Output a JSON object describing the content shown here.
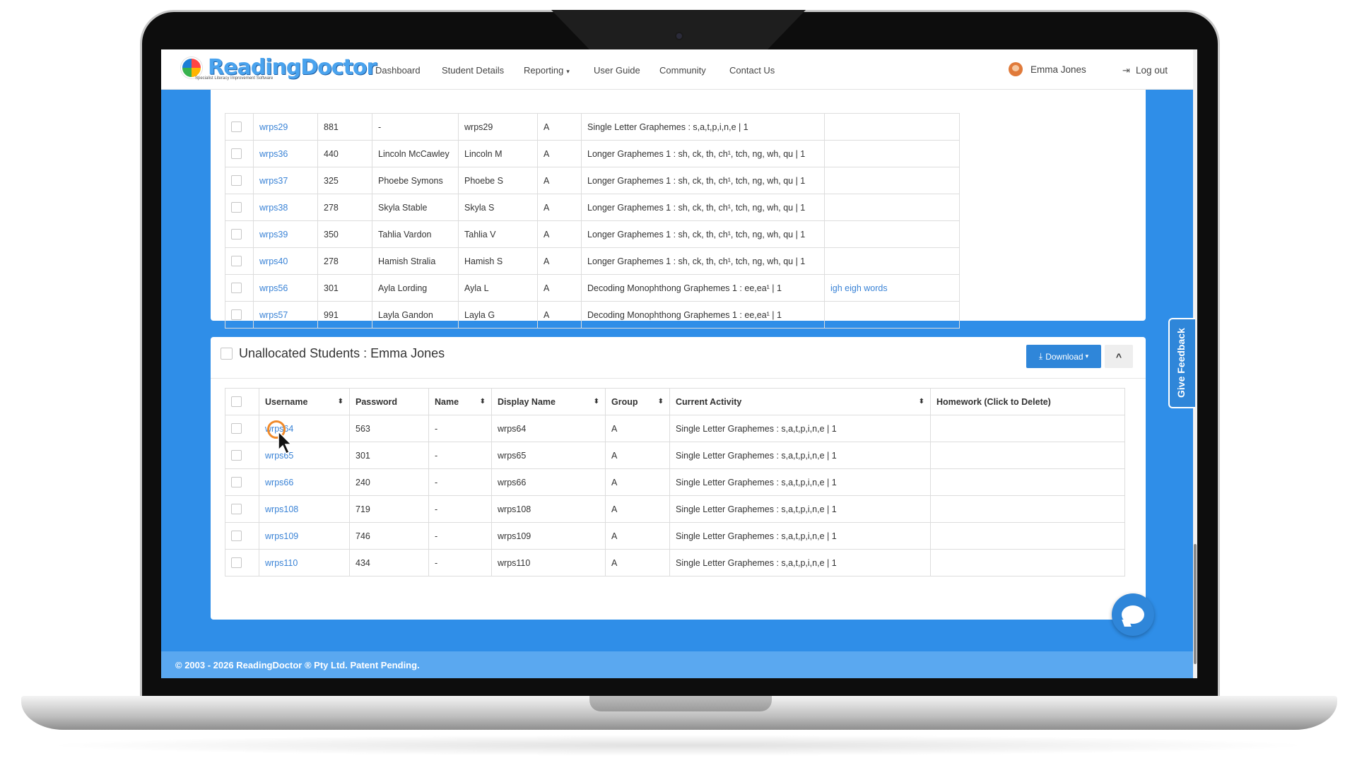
{
  "brand": {
    "name": "ReadingDoctor",
    "tagline": "Specialist Literacy Improvement Software"
  },
  "nav": {
    "items": [
      {
        "label": "Dashboard"
      },
      {
        "label": "Student Details"
      },
      {
        "label": "Reporting",
        "caret": "▾"
      },
      {
        "label": "User Guide"
      },
      {
        "label": "Community"
      },
      {
        "label": "Contact Us"
      }
    ],
    "user_name": "Emma Jones",
    "logout_label": "Log out",
    "logout_icon": "⇥"
  },
  "top_table": {
    "rows": [
      {
        "username": "wrps29",
        "password": "881",
        "name": "-",
        "display": "wrps29",
        "group": "A",
        "activity": "Single Letter Graphemes : s,a,t,p,i,n,e | 1",
        "homework": ""
      },
      {
        "username": "wrps36",
        "password": "440",
        "name": "Lincoln McCawley",
        "display": "Lincoln M",
        "group": "A",
        "activity": "Longer Graphemes 1 : sh, ck, th, ch¹, tch, ng, wh, qu | 1",
        "homework": ""
      },
      {
        "username": "wrps37",
        "password": "325",
        "name": "Phoebe Symons",
        "display": "Phoebe S",
        "group": "A",
        "activity": "Longer Graphemes 1 : sh, ck, th, ch¹, tch, ng, wh, qu | 1",
        "homework": ""
      },
      {
        "username": "wrps38",
        "password": "278",
        "name": "Skyla Stable",
        "display": "Skyla S",
        "group": "A",
        "activity": "Longer Graphemes 1 : sh, ck, th, ch¹, tch, ng, wh, qu | 1",
        "homework": ""
      },
      {
        "username": "wrps39",
        "password": "350",
        "name": "Tahlia Vardon",
        "display": "Tahlia V",
        "group": "A",
        "activity": "Longer Graphemes 1 : sh, ck, th, ch¹, tch, ng, wh, qu | 1",
        "homework": ""
      },
      {
        "username": "wrps40",
        "password": "278",
        "name": "Hamish Stralia",
        "display": "Hamish S",
        "group": "A",
        "activity": "Longer Graphemes 1 : sh, ck, th, ch¹, tch, ng, wh, qu | 1",
        "homework": ""
      },
      {
        "username": "wrps56",
        "password": "301",
        "name": "Ayla Lording",
        "display": "Ayla L",
        "group": "A",
        "activity": "Decoding Monophthong Graphemes 1 : ee,ea¹ | 1",
        "homework": "igh eigh words"
      },
      {
        "username": "wrps57",
        "password": "991",
        "name": "Layla Gandon",
        "display": "Layla G",
        "group": "A",
        "activity": "Decoding Monophthong Graphemes 1 : ee,ea¹ | 1",
        "homework": ""
      }
    ]
  },
  "unallocated": {
    "title": "Unallocated Students : Emma Jones",
    "download_label": "Download",
    "download_icon": "⤓",
    "collapse_icon": "^",
    "headers": {
      "username": "Username",
      "password": "Password",
      "name": "Name",
      "display": "Display Name",
      "group": "Group",
      "activity": "Current Activity",
      "homework": "Homework (Click to Delete)"
    },
    "sort_icon": "⬍",
    "rows": [
      {
        "username": "wrps64",
        "password": "563",
        "name": "-",
        "display": "wrps64",
        "group": "A",
        "activity": "Single Letter Graphemes : s,a,t,p,i,n,e | 1",
        "homework": ""
      },
      {
        "username": "wrps65",
        "password": "301",
        "name": "-",
        "display": "wrps65",
        "group": "A",
        "activity": "Single Letter Graphemes : s,a,t,p,i,n,e | 1",
        "homework": ""
      },
      {
        "username": "wrps66",
        "password": "240",
        "name": "-",
        "display": "wrps66",
        "group": "A",
        "activity": "Single Letter Graphemes : s,a,t,p,i,n,e | 1",
        "homework": ""
      },
      {
        "username": "wrps108",
        "password": "719",
        "name": "-",
        "display": "wrps108",
        "group": "A",
        "activity": "Single Letter Graphemes : s,a,t,p,i,n,e | 1",
        "homework": ""
      },
      {
        "username": "wrps109",
        "password": "746",
        "name": "-",
        "display": "wrps109",
        "group": "A",
        "activity": "Single Letter Graphemes : s,a,t,p,i,n,e | 1",
        "homework": ""
      },
      {
        "username": "wrps110",
        "password": "434",
        "name": "-",
        "display": "wrps110",
        "group": "A",
        "activity": "Single Letter Graphemes : s,a,t,p,i,n,e | 1",
        "homework": ""
      }
    ]
  },
  "footer": {
    "text": "© 2003 - 2026 ReadingDoctor ® Pty Ltd. Patent Pending."
  },
  "feedback": {
    "label": "Give Feedback"
  },
  "colors": {
    "accent": "#2f86d9",
    "background": "#2f8ee8",
    "link": "#3a83d6",
    "footer": "#5aa8f0"
  }
}
